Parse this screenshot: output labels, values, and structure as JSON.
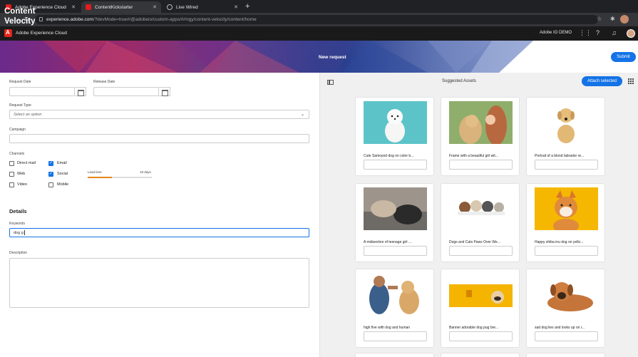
{
  "browser": {
    "tabs": [
      {
        "label": "Adobe Experience Cloud",
        "active": false
      },
      {
        "label": "ContentKickstarter",
        "active": true
      },
      {
        "label": "Live Wired",
        "active": false
      }
    ],
    "url_host": "experience.adobe.com",
    "url_path": "/?devMode=true#/@adobeio/custom-apps/#/mgy/content-velocity/content/home"
  },
  "shell": {
    "title": "Adobe Experience Cloud",
    "org": "Adobe IO DEMO"
  },
  "hero": {
    "title": "Content\nVelocity",
    "center": "New request",
    "submit_label": "Submit"
  },
  "form": {
    "request_date_label": "Request Date",
    "release_date_label": "Release Date",
    "request_type_label": "Request Type",
    "request_type_placeholder": "Select an option",
    "campaign_label": "Campaign",
    "channels_label": "Channels",
    "channels": [
      {
        "label": "Direct mail",
        "checked": false
      },
      {
        "label": "Email",
        "checked": true
      },
      {
        "label": "Web",
        "checked": false
      },
      {
        "label": "Social",
        "checked": true
      },
      {
        "label": "Video",
        "checked": false
      },
      {
        "label": "Mobile",
        "checked": false
      }
    ],
    "lead_time_label": "Lead time",
    "lead_time_value": "19 days",
    "lead_time_fraction": 0.38,
    "details_heading": "Details",
    "keywords_label": "Keywords",
    "keywords_value": "dog g",
    "description_label": "Description"
  },
  "assets": {
    "title": "Suggested Assets",
    "attach_label": "Attach selected",
    "items": [
      {
        "caption": "Cute Samoyed dog on color b..."
      },
      {
        "caption": "Frame with a beautiful girl wit..."
      },
      {
        "caption": "Portrait of a blond labrador re..."
      },
      {
        "caption": "A midsection of teenage girl ..."
      },
      {
        "caption": "Dogs and Cats Paws Over We..."
      },
      {
        "caption": "Happy shiba inu dog on yello..."
      },
      {
        "caption": "high five with dog and human"
      },
      {
        "caption": "Banner adorable dog pug bre..."
      },
      {
        "caption": "sad dog lies and looks up on i..."
      }
    ]
  },
  "colors": {
    "accent": "#1473e6",
    "shell_bg": "#1a1a1a",
    "lead_time_bar": "#e68619"
  }
}
